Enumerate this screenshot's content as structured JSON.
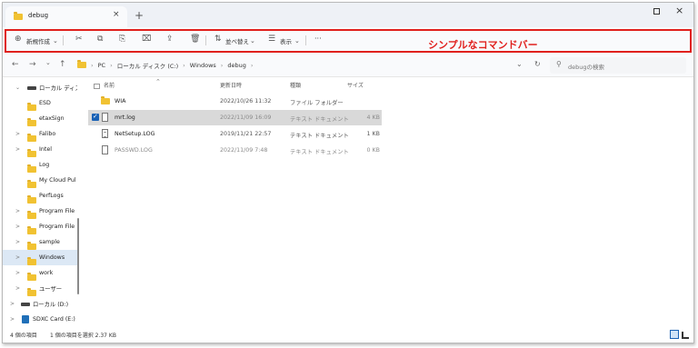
{
  "tab": {
    "title": "debug",
    "close": "×",
    "new_tab": "+"
  },
  "window": {
    "close": "×"
  },
  "command_bar": {
    "new_label": "新規作成",
    "sort_label": "並べ替え",
    "view_label": "表示",
    "more": "···"
  },
  "callout": "シンプルなコマンドバー",
  "address_bar": {
    "back": "←",
    "forward": "→",
    "down": "⌄",
    "up": "↑",
    "crumbs": [
      "PC",
      "ローカル ディスク (C:)",
      "Windows",
      "debug"
    ],
    "refresh": "↻",
    "dropdown": "⌄"
  },
  "search": {
    "placeholder": "debugの検索"
  },
  "sidebar": {
    "items": [
      {
        "label": "ローカル ディスク",
        "chevron": "⌄",
        "icon": "drive"
      },
      {
        "label": "ESD",
        "chevron": "",
        "icon": "folder"
      },
      {
        "label": "etaxSign",
        "chevron": "",
        "icon": "folder"
      },
      {
        "label": "Falibo",
        "chevron": ">",
        "icon": "folder"
      },
      {
        "label": "Intel",
        "chevron": ">",
        "icon": "folder"
      },
      {
        "label": "Log",
        "chevron": "",
        "icon": "folder"
      },
      {
        "label": "My Cloud Pul",
        "chevron": "",
        "icon": "folder"
      },
      {
        "label": "PerfLogs",
        "chevron": "",
        "icon": "folder"
      },
      {
        "label": "Program File",
        "chevron": ">",
        "icon": "folder"
      },
      {
        "label": "Program File",
        "chevron": ">",
        "icon": "folder"
      },
      {
        "label": "sample",
        "chevron": ">",
        "icon": "folder"
      },
      {
        "label": "Windows",
        "chevron": ">",
        "icon": "folder",
        "selected": true
      },
      {
        "label": "work",
        "chevron": ">",
        "icon": "folder"
      },
      {
        "label": "ユーザー",
        "chevron": ">",
        "icon": "folder"
      },
      {
        "label": "ローカル (D:)",
        "chevron": ">",
        "icon": "drive"
      },
      {
        "label": "SDXC Card (E:)",
        "chevron": ">",
        "icon": "sd"
      }
    ]
  },
  "columns": {
    "name": "名前",
    "date": "更新日時",
    "type": "種類",
    "size": "サイズ"
  },
  "files": [
    {
      "name": "WIA",
      "date": "2022/10/26 11:32",
      "type": "ファイル フォルダー",
      "size": "",
      "icon": "folder"
    },
    {
      "name": "mrt.log",
      "date": "2022/11/09 16:09",
      "type": "テキスト ドキュメント",
      "size": "4 KB",
      "icon": "doc",
      "selected": true,
      "checked": true
    },
    {
      "name": "NetSetup.LOG",
      "date": "2019/11/21 22:57",
      "type": "テキスト ドキュメント",
      "size": "1 KB",
      "icon": "doc-lines"
    },
    {
      "name": "PASSWD.LOG",
      "date": "2022/11/09 7:48",
      "type": "テキスト ドキュメント",
      "size": "0 KB",
      "icon": "doc"
    }
  ],
  "status": {
    "count": "4 個の項目",
    "selected": "1 個の項目を選択 2.37 KB"
  }
}
